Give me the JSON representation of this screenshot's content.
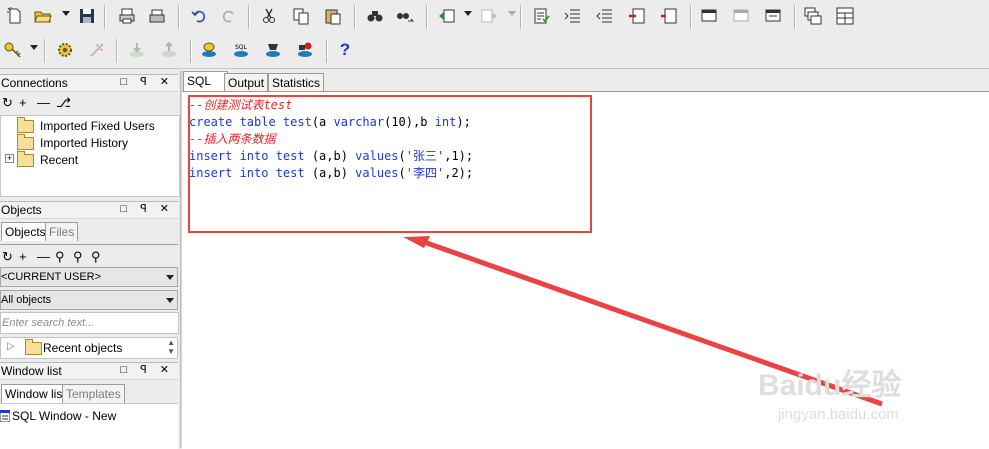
{
  "toolbar1_icons": [
    "new-icon",
    "open-icon",
    "save-icon",
    "print-icon",
    "print-setup-icon",
    "undo-icon",
    "redo-icon",
    "cut-icon",
    "copy-icon",
    "paste-icon",
    "find-icon",
    "find-replace-icon",
    "back-icon",
    "forward-icon",
    "execute-script-icon",
    "indent-icon",
    "unindent-icon",
    "remove-line-icon",
    "clear-icon",
    "window-icon-1",
    "window-icon-2",
    "window-icon-3",
    "cascade-icon",
    "tile-icon"
  ],
  "toolbar2_icons": [
    "key-icon",
    "settings-gear-icon",
    "spark-icon",
    "download-icon",
    "upload-icon",
    "db-commit-icon",
    "sql-icon",
    "db-rollback-icon",
    "db-stop-icon",
    "help-icon"
  ],
  "help_label": "?",
  "connections": {
    "title": "Connections",
    "title_icons": "□ ꟼ ✕",
    "tools": [
      "↻",
      "+",
      "—",
      "⎇"
    ],
    "items": [
      {
        "label": "Imported Fixed Users"
      },
      {
        "label": "Imported History"
      },
      {
        "label": "Recent",
        "expander": "+"
      }
    ]
  },
  "objects": {
    "title": "Objects",
    "title_icons": "□ ꟼ ✕",
    "tabs": [
      "Objects",
      "Files"
    ],
    "tools": [
      "↻",
      "+",
      "—",
      "⚲",
      "⚲",
      "⚲"
    ],
    "user_select": "<CURRENT USER>",
    "filter_select": "All objects",
    "search_placeholder": "Enter search text...",
    "recent_label": "Recent objects"
  },
  "window_list": {
    "title": "Window list",
    "title_icons": "□ ꟼ ✕",
    "tabs": [
      "Window list",
      "Templates"
    ],
    "item": "SQL Window - New"
  },
  "editor": {
    "tabs": [
      "SQL",
      "Output",
      "Statistics"
    ],
    "lines": [
      {
        "type": "comment",
        "text": "--创建测试表test"
      },
      {
        "type": "code",
        "parts": [
          [
            "kw",
            "create table test"
          ],
          [
            "pl",
            "(a "
          ],
          [
            "kw",
            "varchar"
          ],
          [
            "pl",
            "(10),b "
          ],
          [
            "kw",
            "int"
          ],
          [
            "pl",
            ");"
          ]
        ]
      },
      {
        "type": "comment",
        "text": "--插入两条数据"
      },
      {
        "type": "code",
        "parts": [
          [
            "kw",
            "insert into test"
          ],
          [
            "pl",
            " (a,b) "
          ],
          [
            "kw",
            "values"
          ],
          [
            "pl",
            "("
          ],
          [
            "str",
            "'张三'"
          ],
          [
            "pl",
            ",1);"
          ]
        ]
      },
      {
        "type": "code",
        "parts": [
          [
            "kw",
            "insert into test"
          ],
          [
            "pl",
            " (a,b) "
          ],
          [
            "kw",
            "values"
          ],
          [
            "pl",
            "("
          ],
          [
            "str",
            "'李四'"
          ],
          [
            "pl",
            ",2);"
          ]
        ]
      }
    ]
  },
  "annotation": {
    "color": "#ea4343"
  },
  "watermark": {
    "brand": "Baidu经验",
    "url": "jingyan.baidu.com"
  }
}
